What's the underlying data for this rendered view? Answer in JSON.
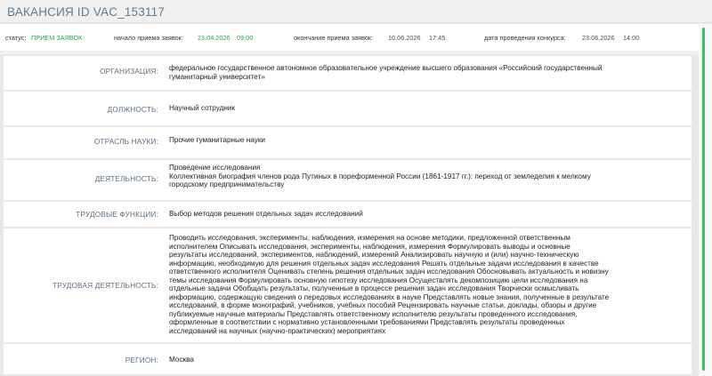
{
  "header": {
    "title": "ВАКАНСИЯ ID VAC_153117"
  },
  "status_bar": {
    "status_label": "статус:",
    "status_value": "ПРИЕМ ЗАЯВОК",
    "start_label": "начало приема заявок:",
    "start_date": "23.04.2026",
    "start_time": "09:00",
    "end_label": "окончание приема заявок:",
    "end_date": "10.06.2026",
    "end_time": "17:45",
    "contest_label": "дата проведения конкурса:",
    "contest_date": "23.06.2026",
    "contest_time": "14:00"
  },
  "fields": {
    "organization": {
      "label": "ОРГАНИЗАЦИЯ:",
      "lines": [
        "федеральное государственное автономное образовательное учреждение высшего образования «Российский государственный",
        "гуманитарный университет»"
      ]
    },
    "position": {
      "label": "ДОЛЖНОСТЬ:",
      "lines": [
        "Научный сотрудник"
      ]
    },
    "science_field": {
      "label": "ОТРАСЛЬ НАУКИ:",
      "lines": [
        "Прочие гуманитарные науки"
      ]
    },
    "activity": {
      "label": "ДЕЯТЕЛЬНОСТЬ:",
      "lines": [
        "Проведение исследования",
        "Коллективная биография членов рода Путиных в пореформенной России (1861-1917 гг.): переход от земледелия к мелкому",
        "городскому предпринимательству"
      ]
    },
    "labor_functions": {
      "label": "ТРУДОВЫЕ ФУНКЦИИ:",
      "lines": [
        "Выбор методов решения отдельных задач исследований"
      ]
    },
    "labor_activity": {
      "label": "ТРУДОВАЯ ДЕЯТЕЛЬНОСТЬ:",
      "lines": [
        "Проводить исследования, эксперименты, наблюдения, измерения на основе методики, предложенной ответственным",
        "исполнителем Описывать исследования, эксперименты, наблюдения, измерения Формулировать выводы и основные",
        "результаты исследований, экспериментов, наблюдений, измерений Анализировать научную и (или) научно-техническую",
        "информацию, необходимую для решения отдельных задач исследования Решать отдельные задачи исследования в качестве",
        "ответственного исполнителя Оценивать степень решения отдельных задач исследования Обосновывать актуальность и новизну",
        "темы исследования Формулировать основную гипотезу исследования Осуществлять декомпозицию цели исследования на",
        "отдельные задачи Обобщать результаты, полученные в процессе решения задач исследования Творчески осмысливать",
        "информацию, содержащую сведения о передовых исследованиях в науке Представлять новые знания, полученные в результате",
        "исследований, в форме монографий, учебников, учебных пособий Рецензировать научные статьи, доклады, обзоры и другие",
        "публикуемые научные материалы Представлять ответственному исполнителю результаты проведенного исследования,",
        "оформленные в соответствии с нормативно установленными требованиями Представлять результаты проведенных",
        "исследований на научных (научно-практических) мероприятиях"
      ]
    },
    "region": {
      "label": "РЕГИОН:",
      "lines": [
        "Москва"
      ]
    }
  },
  "colors": {
    "accent_green": "#28a745",
    "label_blue": "#5a6f82",
    "scrollbar": "#3cc462"
  }
}
